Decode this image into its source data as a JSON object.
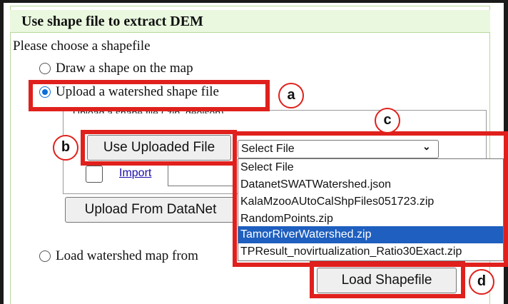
{
  "panel": {
    "title": "Use shape file to extract DEM"
  },
  "prompt": "Please choose a shapefile",
  "options": {
    "draw": "Draw a shape on the map",
    "upload": "Upload a watershed shape file",
    "load_map": "Load watershed map from"
  },
  "upload_section": {
    "legend": "Upload a shape file (.zip,.geojson)",
    "use_uploaded_label": "Use Uploaded File",
    "import_link": "Import",
    "upload_from_datanet_label": "Upload From DataNet"
  },
  "file_select": {
    "selected_value": "Select File",
    "dropdown_items": [
      "Select File",
      "DatanetSWATWatershed.json",
      "KalaMzooAUtoCalShpFiles051723.zip",
      "RandomPoints.zip",
      "TamorRiverWatershed.zip",
      "TPResult_novirtualization_Ratio30Exact.zip"
    ],
    "highlighted_item": "TamorRiverWatershed.zip"
  },
  "load_shapefile_label": "Load Shapefile",
  "annotations": [
    "a",
    "b",
    "c",
    "d"
  ],
  "colors": {
    "annotation_red": "#e0201c",
    "header_green": "#eaf8df",
    "selection_blue": "#1e5fbf",
    "link_blue": "#1a0dab"
  }
}
